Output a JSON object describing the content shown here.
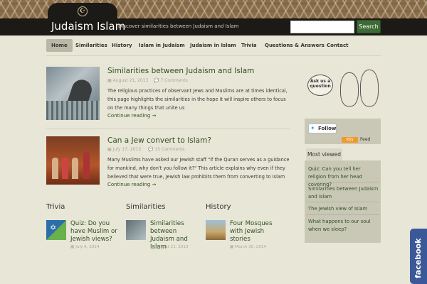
{
  "header": {
    "site_title": "Judaism Islam",
    "tagline": "Discover similarities between Judaism and Islam",
    "search_placeholder": "",
    "search_button": "Search"
  },
  "nav": {
    "items": [
      {
        "label": "Home",
        "active": true
      },
      {
        "label": "Similarities"
      },
      {
        "label": "History"
      },
      {
        "label": "Islam in Judaism"
      },
      {
        "label": "Judaism in Islam"
      },
      {
        "label": "Trivia"
      },
      {
        "label": "Questions & Answers"
      },
      {
        "label": "Contact"
      }
    ]
  },
  "posts": [
    {
      "title": "Similarities between Judaism and Islam",
      "date": "August 21, 2013",
      "comments": "7 Comments",
      "excerpt": "The religious practices of observant Jews and Muslims are at times identical, this page highlights the similarities in the hope it will inspire others to focus on the many things that unite us",
      "more": "Continue reading →"
    },
    {
      "title": "Can a Jew convert to Islam?",
      "date": "July 17, 2013",
      "comments": "15 Comments",
      "excerpt": "Many Muslims have asked our Jewish staff \"if the Quran serves as a guidance for mankind, why don't you follow it?\" This article explains why even if they believed that were true, Jewish law prohibits them from converting to Islam",
      "more": "Continue reading →"
    }
  ],
  "categories": [
    {
      "heading": "Trivia",
      "link": "Quiz: Do you have Muslim or Jewish views?",
      "date": "July 6, 2014"
    },
    {
      "heading": "Similarities",
      "link": "Similarities between Judaism and Islam",
      "date": "August 21, 2013"
    },
    {
      "heading": "History",
      "link": "Four Mosques with Jewish stories",
      "date": "March 30, 2014"
    }
  ],
  "sidebar": {
    "ask_label": "Ask us a question",
    "follow_label": "Follow",
    "rss_label": "RSS",
    "feed_label": "Feed",
    "most_viewed_tab": "Most viewed",
    "most_viewed": [
      "Quiz: Can you tell her religion from her head covering?",
      "Similarities between Judaism and Islam",
      "The Jewish view of Islam",
      "What happens to our soul when we sleep?"
    ]
  },
  "facebook_tab": "facebook",
  "colors": {
    "link_green": "#2e5024",
    "header_dark": "#1c1a17",
    "search_green": "#3d6b35",
    "facebook_blue": "#3b5998"
  }
}
